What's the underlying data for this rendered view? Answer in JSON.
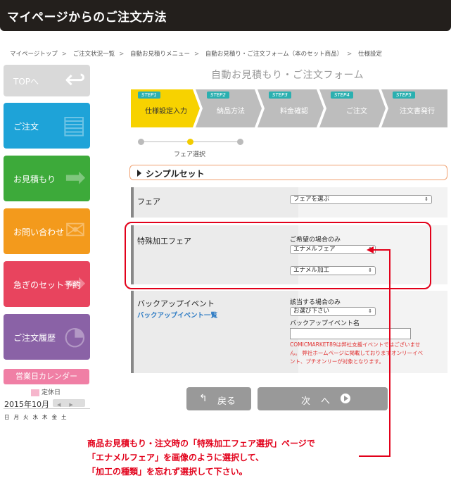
{
  "header": {
    "title": "マイページからのご注文方法"
  },
  "breadcrumb": {
    "items": [
      "マイページトップ",
      "ご注文状況一覧",
      "自動お見積りメニュー",
      "自動お見積り・ご注文フォーム（本のセット商品）",
      "仕様設定"
    ],
    "separator": ">"
  },
  "sidebar": {
    "items": [
      {
        "label": "TOPへ",
        "color": "#d9d9d9"
      },
      {
        "label": "ご注文",
        "color": "#1ea3d8"
      },
      {
        "label": "お見積もり",
        "color": "#3daa3a"
      },
      {
        "label": "お問い合わせ",
        "color": "#f39a1c"
      },
      {
        "label": "急ぎのセット予約",
        "color": "#e8445e"
      },
      {
        "label": "ご注文履歴",
        "color": "#8a62a6"
      }
    ],
    "calendar_button": "営業日カレンダー",
    "legend": "定休日",
    "month": "2015年10月",
    "weekdays": [
      "日",
      "月",
      "火",
      "水",
      "木",
      "金",
      "土"
    ]
  },
  "form": {
    "title": "自動お見積もり・ご注文フォーム",
    "steps": [
      {
        "tag": "STEP1",
        "name": "仕様設定入力"
      },
      {
        "tag": "STEP2",
        "name": "納品方法"
      },
      {
        "tag": "STEP3",
        "name": "料金確認"
      },
      {
        "tag": "STEP4",
        "name": "ご注文"
      },
      {
        "tag": "STEP5",
        "name": "注文書発行"
      }
    ],
    "progress_label": "フェア選択",
    "section_title": "シンプルセット",
    "fair": {
      "label": "フェア",
      "select_value": "フェアを選ぶ"
    },
    "special": {
      "label": "特殊加工フェア",
      "hint": "ご希望の場合のみ",
      "select1": "エナメルフェア",
      "select2": "エナメル加工"
    },
    "backup": {
      "label": "バックアップイベント",
      "link": "バックアップイベント一覧",
      "hint": "該当する場合のみ",
      "select": "お選び下さい",
      "name_label": "バックアップイベント名",
      "note_lines": [
        "COMICMARKET89は弊社支援イベントではございませ",
        "ん。 弊社ホームページに掲載しておりますオンリーイベ",
        "ント、プチオンリーが対象となります。"
      ]
    },
    "back_button": "戻る",
    "next_button": "次　へ"
  },
  "caption": {
    "lines": [
      "商品お見積もり・注文時の「特殊加工フェア選択」ページで",
      "「エナメルフェア」を画像のように選択して、",
      "「加工の種類」を忘れず選択して下さい。"
    ]
  },
  "colors": {
    "highlight": "#e2001a",
    "active_step": "#f7d200",
    "inactive_step": "#bdbdbd",
    "header_bg": "#231f1c"
  }
}
